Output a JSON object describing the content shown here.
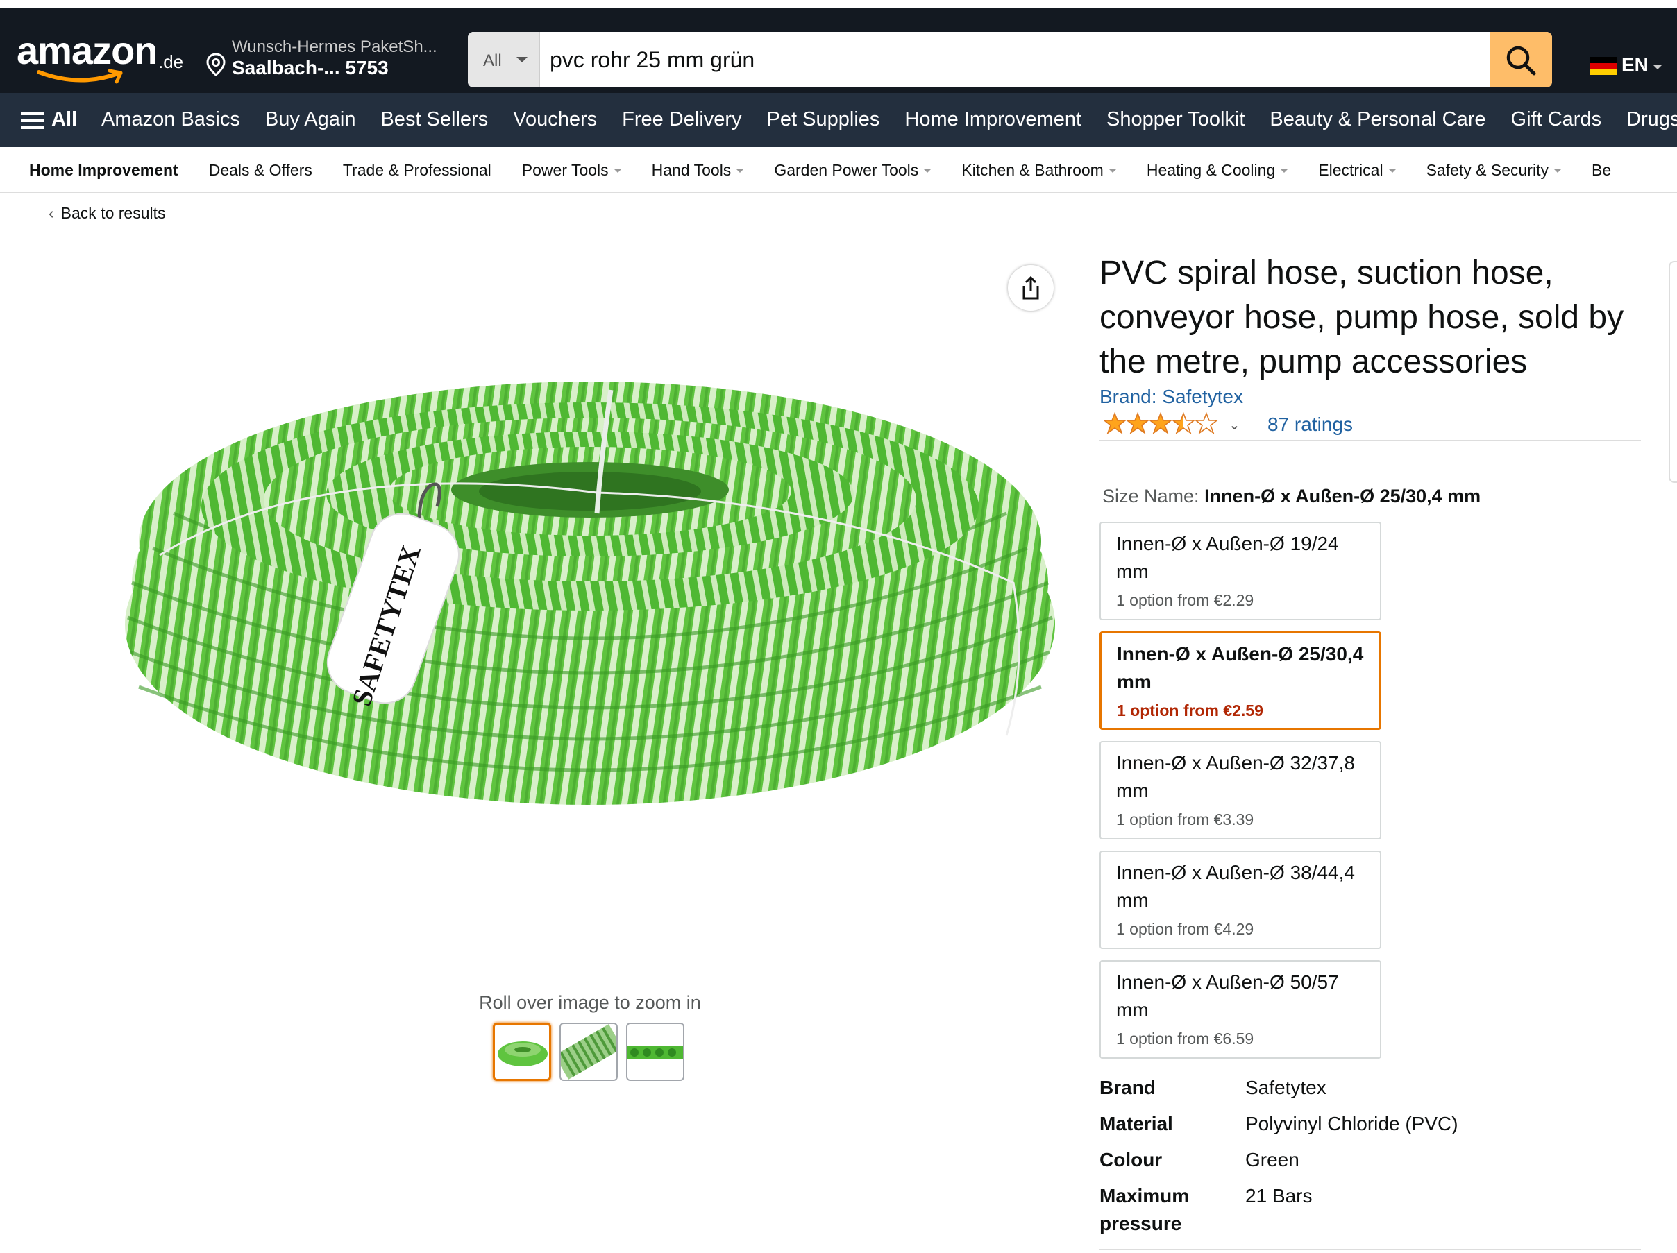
{
  "header": {
    "logo_text": "amazon",
    "logo_tld": ".de",
    "deliver_line1": "Wunsch-Hermes PaketSh...",
    "deliver_line2": "Saalbach-... 5753",
    "search_category": "All",
    "search_value": "pvc rohr 25 mm grün",
    "language": "EN",
    "colors": {
      "header_bg": "#131921",
      "nav_bg": "#232f3e",
      "search_button": "#febd69"
    }
  },
  "nav": {
    "all_label": "All",
    "items": [
      "Amazon Basics",
      "Buy Again",
      "Best Sellers",
      "Vouchers",
      "Free Delivery",
      "Pet Supplies",
      "Home Improvement",
      "Shopper Toolkit",
      "Beauty & Personal Care",
      "Gift Cards",
      "Drugstore"
    ]
  },
  "subnav": {
    "items": [
      "Home Improvement",
      "Deals & Offers",
      "Trade & Professional",
      "Power Tools",
      "Hand Tools",
      "Garden Power Tools",
      "Kitchen & Bathroom",
      "Heating & Cooling",
      "Electrical",
      "Safety & Security",
      "Be"
    ]
  },
  "back_link": "Back to results",
  "gallery": {
    "zoom_hint": "Roll over image to zoom in",
    "tag_text": "SAFETYTEX",
    "thumbnail_count": 3
  },
  "product": {
    "title": "PVC spiral hose, suction hose, conveyor hose, pump hose, sold by the metre, pump accessories",
    "brand_link": "Brand: Safetytex",
    "rating_stars": 3.5,
    "ratings_count": "87 ratings",
    "size_label_prefix": "Size Name:",
    "size_label_value": "Innen-Ø x Außen-Ø 25/30,4 mm",
    "options": [
      {
        "title": "Innen-Ø x Außen-Ø 19/24 mm",
        "price": "1 option from €2.29",
        "selected": false
      },
      {
        "title": "Innen-Ø x Außen-Ø 25/30,4 mm",
        "price": "1 option from €2.59",
        "selected": true
      },
      {
        "title": "Innen-Ø x Außen-Ø 32/37,8 mm",
        "price": "1 option from €3.39",
        "selected": false
      },
      {
        "title": "Innen-Ø x Außen-Ø 38/44,4 mm",
        "price": "1 option from €4.29",
        "selected": false
      },
      {
        "title": "Innen-Ø x Außen-Ø 50/57 mm",
        "price": "1 option from €6.59",
        "selected": false
      }
    ],
    "specs": [
      {
        "key": "Brand",
        "value": "Safetytex"
      },
      {
        "key": "Material",
        "value": "Polyvinyl Chloride (PVC)"
      },
      {
        "key": "Colour",
        "value": "Green"
      },
      {
        "key": "Maximum pressure",
        "value": "21 Bars"
      }
    ]
  }
}
